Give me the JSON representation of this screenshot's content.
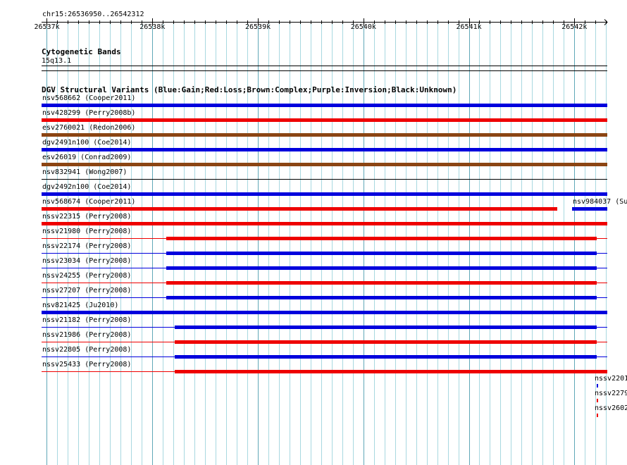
{
  "ruler": {
    "coordinate_label": "chr15:26536950..26542312",
    "start": 26536950,
    "end": 26542312,
    "ticks": [
      {
        "value": 26537000,
        "label": "26537k"
      },
      {
        "value": 26538000,
        "label": "26538k"
      },
      {
        "value": 26539000,
        "label": "26539k"
      },
      {
        "value": 26540000,
        "label": "26540k"
      },
      {
        "value": 26541000,
        "label": "26541k"
      },
      {
        "value": 26542000,
        "label": "26542k"
      }
    ]
  },
  "cyto_track": {
    "title": "Cytogenetic Bands",
    "band": "15q13.1"
  },
  "dgv_track": {
    "title": "DGV Structural Variants (Blue:Gain;Red:Loss;Brown:Complex;Purple:Inversion;Black:Unknown)"
  },
  "colors": {
    "gain": "#0000dd",
    "loss": "#ee0000",
    "complex": "#8b4513",
    "gridline": "#a8d8e0",
    "dark_gridline": "#60a8b8"
  },
  "variants": [
    {
      "label": "nsv568662 (Cooper2011)",
      "type": "gain",
      "start": 26536950,
      "end": 26542312,
      "thin": false
    },
    {
      "label": "nsv428299 (Perry2008b)",
      "type": "loss",
      "start": 26536950,
      "end": 26542312,
      "thin": false
    },
    {
      "label": "esv2760021 (Redon2006)",
      "type": "complex",
      "start": 26536950,
      "end": 26542312,
      "thin": false
    },
    {
      "label": "dgv2491n100 (Coe2014)",
      "type": "gain",
      "start": 26536950,
      "end": 26542312,
      "thin": false
    },
    {
      "label": "esv26019 (Conrad2009)",
      "type": "complex",
      "start": 26536950,
      "end": 26542312,
      "thin": false
    },
    {
      "label": "nsv832941 (Wong2007)",
      "type": "unknown",
      "start": 26536950,
      "end": 26542312,
      "thin": true
    },
    {
      "label": "dgv2492n100 (Coe2014)",
      "type": "gain",
      "start": 26536950,
      "end": 26542312,
      "thin": false
    },
    {
      "label": "nsv568674 (Cooper2011)",
      "type": "loss",
      "start": 26536950,
      "end": 26541840,
      "thin": false
    },
    {
      "label": "nsv984037 (Su",
      "type": "gain",
      "start": 26541980,
      "end": 26542312,
      "thin": false
    },
    {
      "label": "nssv22315 (Perry2008)",
      "type": "loss",
      "start": 26536950,
      "end": 26542312,
      "thin": false
    },
    {
      "label": "nssv21980 (Perry2008)",
      "type": "loss",
      "start": 26538130,
      "end": 26542210,
      "thin": false
    },
    {
      "label": "nssv22174 (Perry2008)",
      "type": "gain",
      "start": 26538130,
      "end": 26542210,
      "thin": false
    },
    {
      "label": "nssv23034 (Perry2008)",
      "type": "gain",
      "start": 26538130,
      "end": 26542210,
      "thin": false
    },
    {
      "label": "nssv24255 (Perry2008)",
      "type": "loss",
      "start": 26538130,
      "end": 26542210,
      "thin": false
    },
    {
      "label": "nssv27207 (Perry2008)",
      "type": "gain",
      "start": 26538130,
      "end": 26542210,
      "thin": false
    },
    {
      "label": "nsv821425 (Ju2010)",
      "type": "gain",
      "start": 26536950,
      "end": 26542312,
      "thin": false
    },
    {
      "label": "nssv21182 (Perry2008)",
      "type": "gain",
      "start": 26538210,
      "end": 26542210,
      "thin": false
    },
    {
      "label": "nssv21986 (Perry2008)",
      "type": "loss",
      "start": 26538210,
      "end": 26542210,
      "thin": false
    },
    {
      "label": "nssv22805 (Perry2008)",
      "type": "gain",
      "start": 26538210,
      "end": 26542210,
      "thin": false
    },
    {
      "label": "nssv25433 (Perry2008)",
      "type": "loss",
      "start": 26538210,
      "end": 26542312,
      "thin": false
    },
    {
      "label": "nssv2201",
      "type": "gain",
      "start": 26542210,
      "end": 26542220,
      "thin": false
    },
    {
      "label": "nssv2279",
      "type": "loss",
      "start": 26542210,
      "end": 26542220,
      "thin": false
    },
    {
      "label": "nssv2602",
      "type": "loss",
      "start": 26542210,
      "end": 26542220,
      "thin": false
    }
  ]
}
